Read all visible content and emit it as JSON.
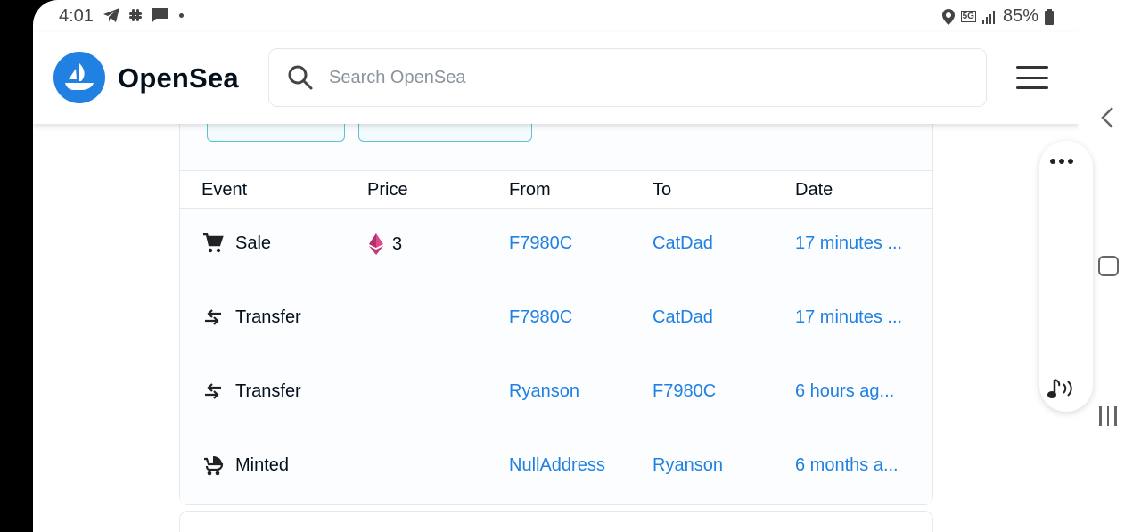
{
  "status_bar": {
    "time": "4:01",
    "network": "5G",
    "battery": "85%"
  },
  "header": {
    "brand": "OpenSea",
    "search_placeholder": "Search OpenSea",
    "accent_color": "#2081e2"
  },
  "activity_table": {
    "headers": [
      "Event",
      "Price",
      "From",
      "To",
      "Date"
    ],
    "rows": [
      {
        "event": "Sale",
        "event_icon": "cart-icon",
        "price": "3",
        "from": "F7980C",
        "to": "CatDad",
        "date": "17 minutes ..."
      },
      {
        "event": "Transfer",
        "event_icon": "transfer-icon",
        "price": "",
        "from": "F7980C",
        "to": "CatDad",
        "date": "17 minutes ..."
      },
      {
        "event": "Transfer",
        "event_icon": "transfer-icon",
        "price": "",
        "from": "Ryanson",
        "to": "F7980C",
        "date": "6 hours ag..."
      },
      {
        "event": "Minted",
        "event_icon": "stroller-icon",
        "price": "",
        "from": "NullAddress",
        "to": "Ryanson",
        "date": "6 months a..."
      }
    ]
  }
}
